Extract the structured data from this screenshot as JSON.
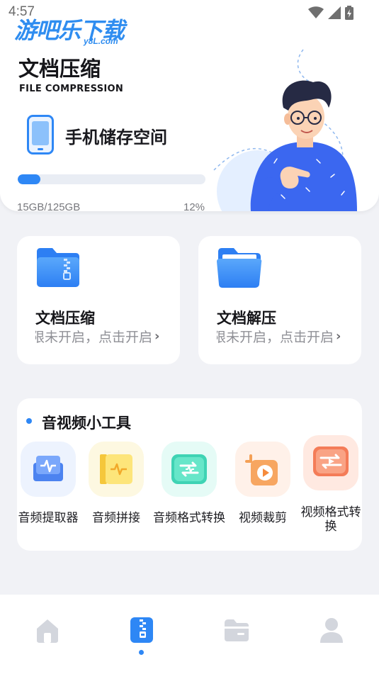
{
  "status_bar": {
    "time": "4:57",
    "icons": [
      "wifi-icon",
      "signal-icon",
      "battery-icon"
    ]
  },
  "watermark": {
    "text": "游吧乐下载",
    "sub": "y8L.com"
  },
  "header": {
    "title": "文档压缩",
    "subtitle": "FILE COMPRESSION",
    "storage_label": "手机储存空间",
    "storage_used": "15GB/125GB",
    "storage_percent_text": "12%",
    "storage_fraction": 0.12
  },
  "features": [
    {
      "title": "文档压缩",
      "desc": "限未开启，点击开启",
      "icon": "zip-folder-icon"
    },
    {
      "title": "文档解压",
      "desc": "限未开启，点击开启",
      "icon": "open-folder-icon"
    }
  ],
  "tools": {
    "title": "音视频小工具",
    "items": [
      {
        "label": "音频提取器",
        "icon": "audio-extract-icon"
      },
      {
        "label": "音频拼接",
        "icon": "audio-join-icon"
      },
      {
        "label": "音频格式转换",
        "icon": "audio-convert-icon"
      },
      {
        "label": "视频裁剪",
        "icon": "video-crop-icon"
      },
      {
        "label": "视频格式转换",
        "icon": "video-convert-icon"
      }
    ]
  },
  "nav": {
    "items": [
      "home-icon",
      "compress-icon",
      "folder-icon",
      "profile-icon"
    ],
    "active_index": 1
  },
  "colors": {
    "accent": "#2e87f5",
    "background": "#f1f2f6",
    "nav_inactive": "#d3d6dd"
  }
}
